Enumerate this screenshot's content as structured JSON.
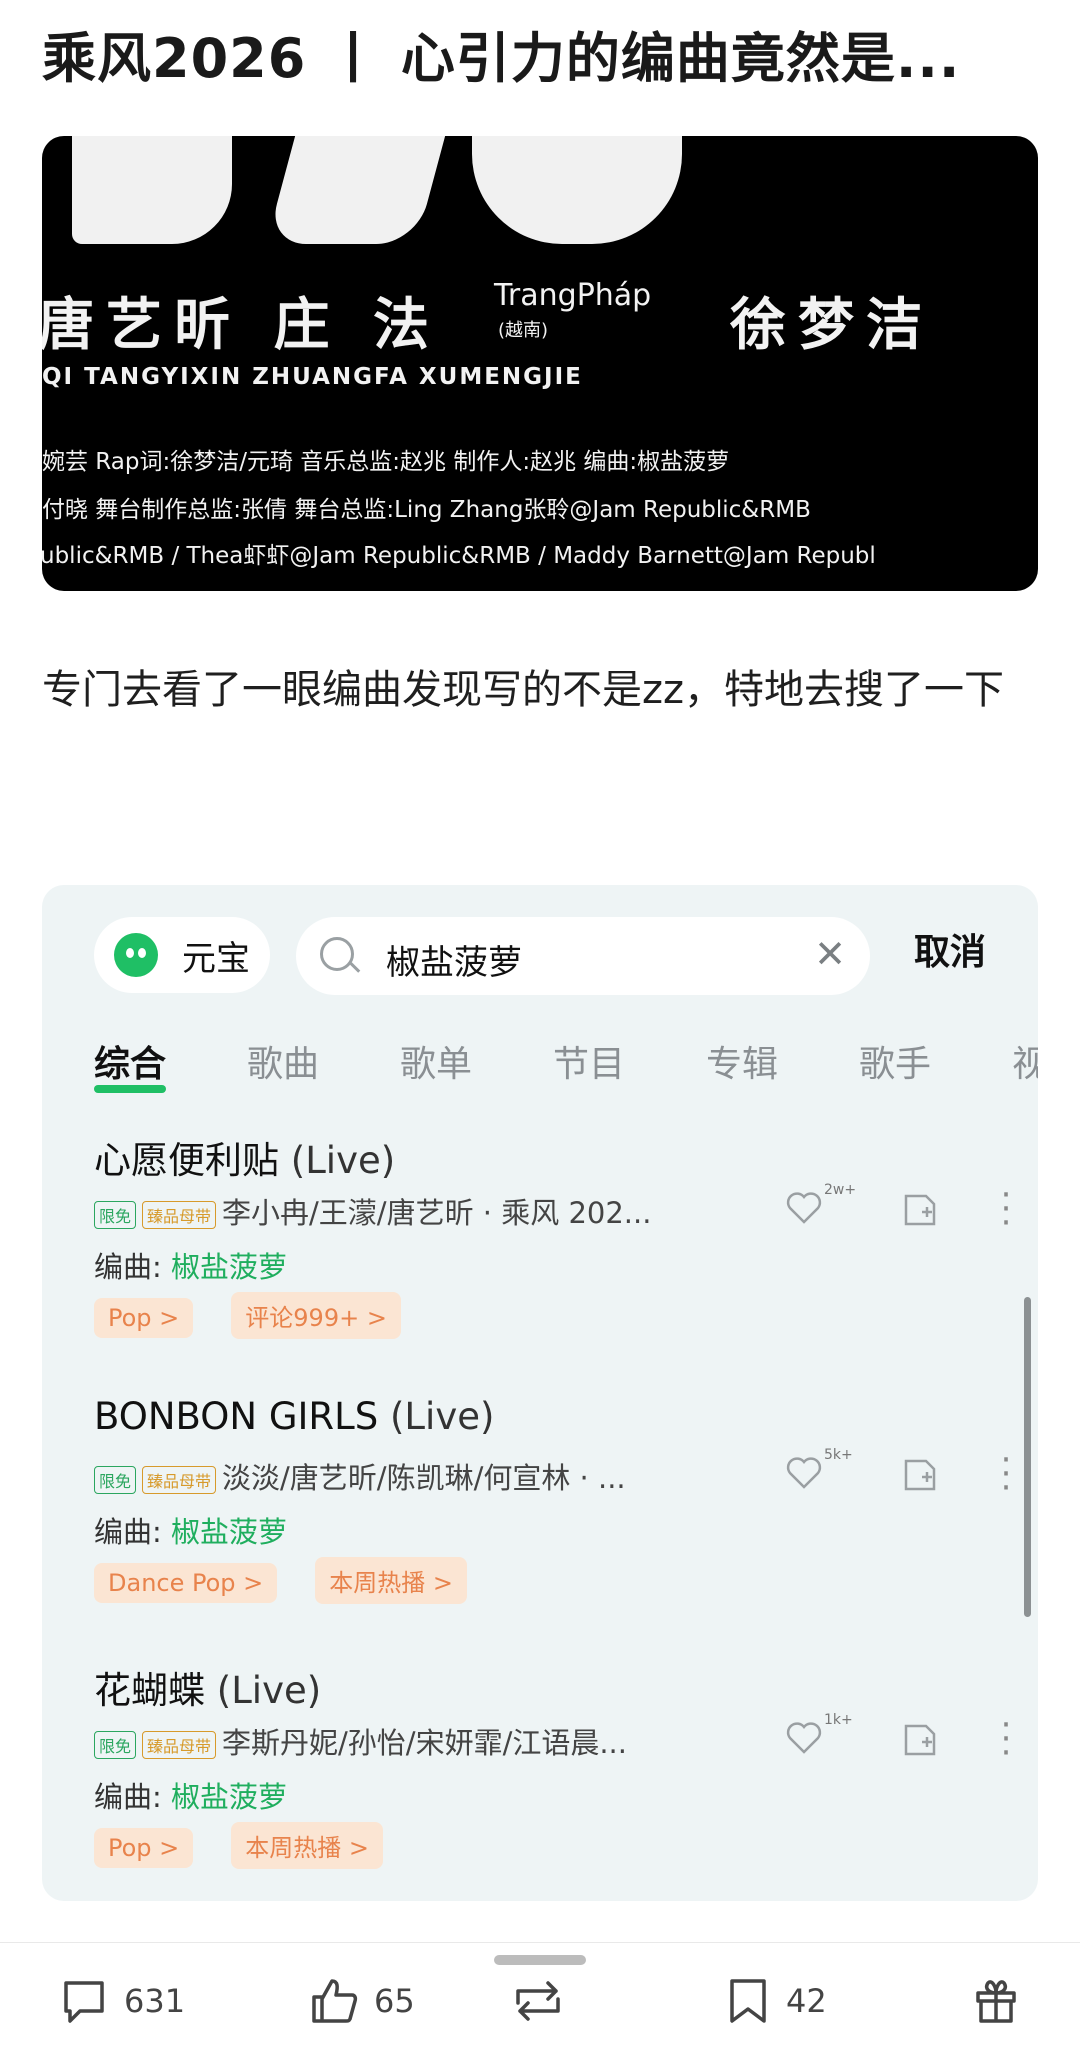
{
  "post": {
    "title": "乘风2026 丨 心引力的编曲竟然是...",
    "image_text": {
      "names": "唐艺昕   庄 法",
      "trang": "TrangPháp",
      "trang_sub": "(越南)",
      "name3": "徐梦洁",
      "latin": "QI  TANGYIXIN  ZHUANGFA  XUMENGJIE",
      "credit1": "婉芸   Rap词:徐梦洁/元琦   音乐总监:赵兆   制作人:赵兆   编曲:椒盐菠萝",
      "credit2": "付晓   舞台制作总监:张倩   舞台总监:Ling Zhang张聆@Jam Republic&RMB",
      "credit3": "ublic&RMB / Thea虾虾@Jam Republic&RMB / Maddy Barnett@Jam Republ"
    },
    "body": "专门去看了一眼编曲发现写的不是zz，特地去搜了一下"
  },
  "app": {
    "yuanbao_label": "元宝",
    "search_value": "椒盐菠萝",
    "cancel_label": "取消",
    "tabs": [
      "综合",
      "歌曲",
      "歌单",
      "节目",
      "专辑",
      "歌手",
      "视"
    ],
    "badge_free": "限免",
    "badge_master": "臻品母带",
    "arranger_label": "编曲: ",
    "songs": [
      {
        "title": "心愿便利贴",
        "suffix": " (Live)",
        "artists": "李小冉/王濛/唐艺昕 · 乘风 202...",
        "arranger": "椒盐菠萝",
        "likes": "2w+",
        "tags": [
          "Pop >",
          "评论999+ >"
        ]
      },
      {
        "title": "BONBON GIRLS",
        "suffix": " (Live)",
        "artists": "淡淡/唐艺昕/陈凯琳/何宣林 · ...",
        "arranger": "椒盐菠萝",
        "likes": "5k+",
        "tags": [
          "Dance Pop >",
          "本周热播 >"
        ]
      },
      {
        "title": "花蝴蝶",
        "suffix": " (Live)",
        "artists": "李斯丹妮/孙怡/宋妍霏/江语晨...",
        "arranger": "椒盐菠萝",
        "likes": "1k+",
        "tags": [
          "Pop >",
          "本周热播 >"
        ]
      }
    ]
  },
  "bottom_bar": {
    "comments": "631",
    "likes": "65",
    "bookmarks": "42"
  },
  "colors": {
    "accent_green": "#1fbf65",
    "tag_bg": "#fbe5d3",
    "tag_text": "#e8834c"
  }
}
